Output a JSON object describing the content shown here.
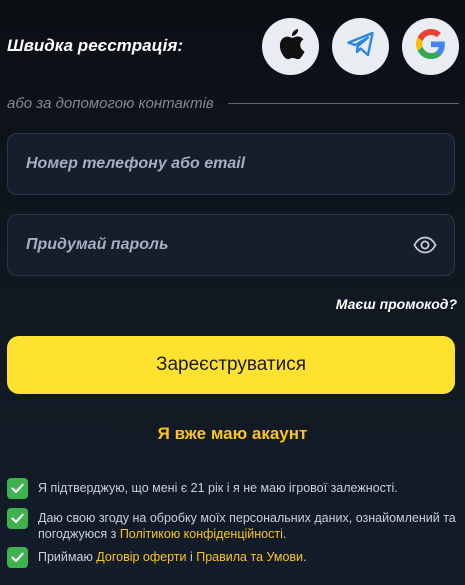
{
  "quick_registration": {
    "title": "Швидка реєстрація:",
    "providers": [
      {
        "name": "apple",
        "icon": "apple-icon"
      },
      {
        "name": "telegram",
        "icon": "telegram-icon"
      },
      {
        "name": "google",
        "icon": "google-icon"
      }
    ]
  },
  "divider": {
    "label": "або за допомогою контактів"
  },
  "form": {
    "contact_placeholder": "Номер телефону або email",
    "password_placeholder": "Придумай пароль",
    "password_toggle_icon": "eye-icon",
    "promo_link": "Маєш промокод?",
    "submit_label": "Зареєструватися",
    "login_link": "Я вже маю акаунт"
  },
  "consents": [
    {
      "checked": true,
      "text": "Я підтверджую, що мені є 21 рік і я не маю ігрової залежності."
    },
    {
      "checked": true,
      "text_before": "Даю свою згоду на обробку моїх персональних даних, ознайомлений та погоджуюся з ",
      "link": "Політикою конфіденційності",
      "text_after": "."
    },
    {
      "checked": true,
      "text_before": "Приймаю ",
      "link1": "Договір оферти",
      "text_middle": " і ",
      "link2": "Правила та Умови",
      "text_after": "."
    }
  ],
  "colors": {
    "accent_yellow": "#fde22f",
    "link_yellow": "#fbc51e",
    "check_green": "#3eb24f",
    "background": "#0f1419",
    "field_background": "#151e2a"
  }
}
